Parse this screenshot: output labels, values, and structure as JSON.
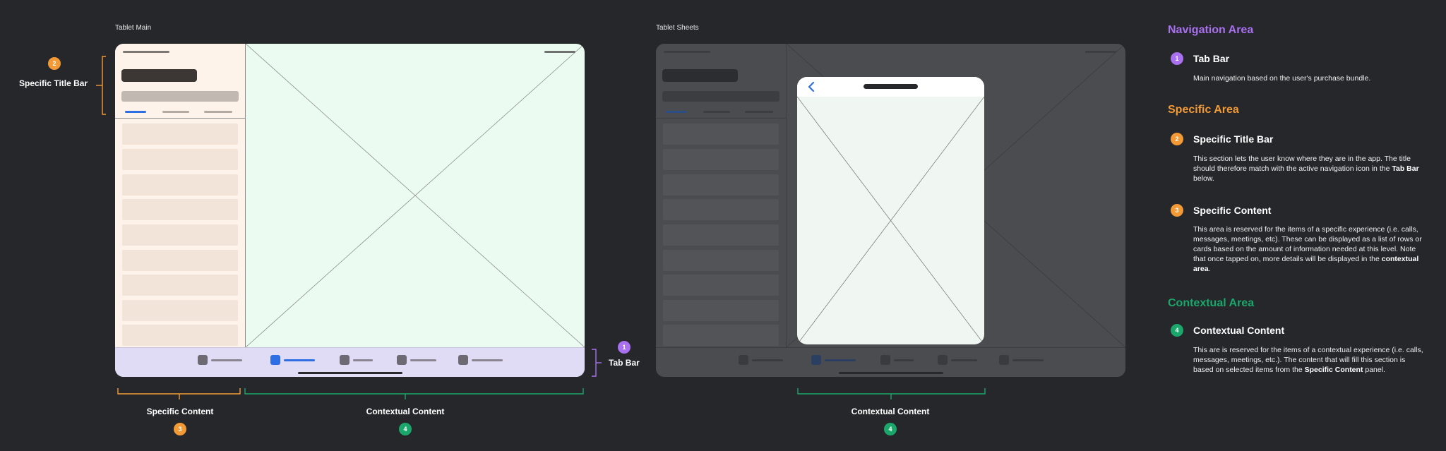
{
  "frames": {
    "main_label": "Tablet Main",
    "sheets_label": "Tablet Sheets"
  },
  "annotations": {
    "specific_title_bar": "Specific Title Bar",
    "tab_bar": "Tab Bar",
    "specific_content": "Specific Content",
    "contextual_content": "Contextual Content",
    "contextual_content_sheets": "Contextual Content"
  },
  "badges": {
    "one": "1",
    "two": "2",
    "three": "3",
    "four": "4"
  },
  "colors": {
    "navigation": "#a970f0",
    "specific": "#f39a36",
    "contextual": "#1ba76b",
    "active_tab": "#2f6fe4",
    "background": "#25272b"
  },
  "legend": {
    "navigation_area": {
      "title": "Navigation Area",
      "items": [
        {
          "badge": "1",
          "title": "Tab Bar",
          "desc_parts": [
            "Main navigation based on the user's purchase bundle."
          ]
        }
      ]
    },
    "specific_area": {
      "title": "Specific Area",
      "items": [
        {
          "badge": "2",
          "title": "Specific Title Bar",
          "desc_parts": [
            "This section lets the user know where they are in the app. The title should therefore match with the active navigation icon in the ",
            "Tab Bar",
            " below."
          ]
        },
        {
          "badge": "3",
          "title": "Specific Content",
          "desc_parts": [
            "This area is reserved for the items of a specific experience (i.e. calls, messages, meetings, etc). These can be displayed as a list of rows or cards based on the amount of information needed at this level. Note that once tapped on, more details will be displayed in the ",
            "contextual area",
            "."
          ]
        }
      ]
    },
    "contextual_area": {
      "title": "Contextual Area",
      "items": [
        {
          "badge": "4",
          "title": "Contextual Content",
          "desc_parts": [
            "This are is reserved for the items of a contextual experience (i.e. calls, messages, meetings, etc.). The content that will fill this section is based on selected items from the ",
            "Specific Content",
            " panel."
          ]
        }
      ]
    }
  },
  "icons": {
    "back": "chevron-left-icon",
    "placeholder": "image-placeholder-icon"
  }
}
